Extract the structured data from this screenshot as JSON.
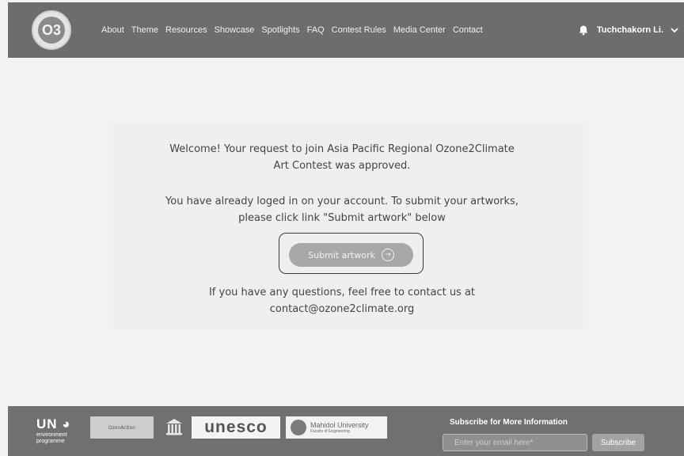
{
  "header": {
    "logo_text": "O3",
    "nav": [
      "About",
      "Theme",
      "Resources",
      "Showcase",
      "Spotlights",
      "FAQ",
      "Contest Rules",
      "Media Center",
      "Contact"
    ],
    "user_name": "Tuchchakorn Li.",
    "icons": {
      "notifications": "bell-icon",
      "user_menu": "chevron-down-icon"
    }
  },
  "main": {
    "welcome_line1": "Welcome! Your request to join Asia Pacific Regional Ozone2Climate",
    "welcome_line2": "Art Contest was approved.",
    "login_line1": "You have already loged in on your account. To submit your artworks,",
    "login_line2": "please click link \"Submit artwork\" below",
    "submit_label": "Submit artwork",
    "questions_line1": "If you have any questions, feel free to contact us at",
    "questions_line2": "contact@ozone2climate.org"
  },
  "footer": {
    "un_logo": {
      "big": "UN",
      "line1": "environment",
      "line2": "programme"
    },
    "ozone_action": "OzonAction",
    "unesco": "unesco",
    "mahidol": {
      "name": "Mahidol University",
      "sub": "Faculty of Engineering"
    },
    "subscribe_title": "Subscribe for More Information",
    "email_placeholder": "Enter your email here*",
    "subscribe_label": "Subscribe"
  },
  "colors": {
    "header_bg": "#6d6d6d",
    "footer_bg": "#707070",
    "button_bg": "#a8a8a8"
  }
}
